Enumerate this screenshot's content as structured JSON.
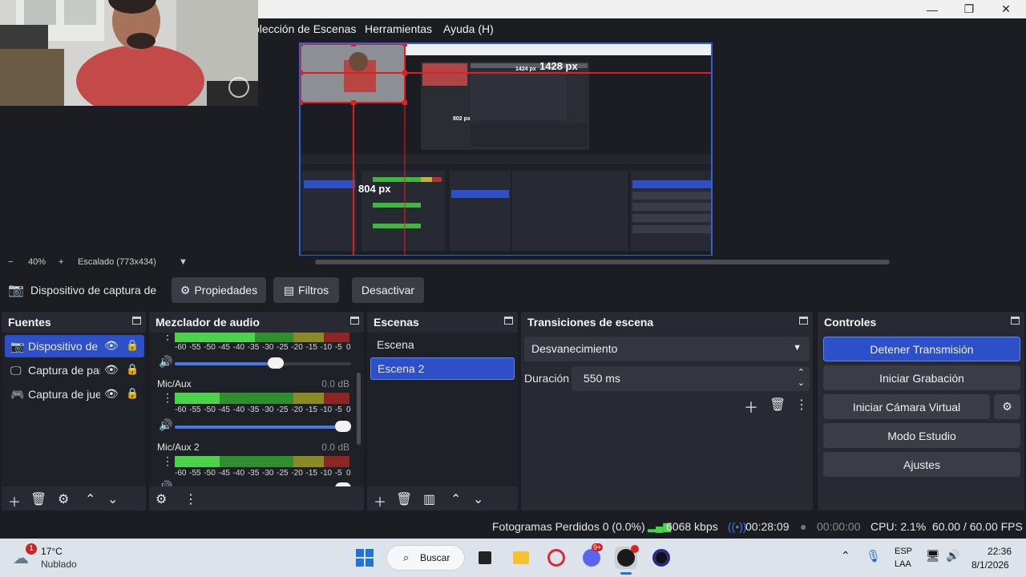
{
  "window": {
    "minimize_glyph": "—",
    "maximize_glyph": "❐",
    "close_glyph": "✕"
  },
  "menu": {
    "items": [
      "olección de Escenas",
      "Herramientas",
      "Ayuda (H)"
    ]
  },
  "preview": {
    "width_label": "1428 px",
    "height_label": "804 px",
    "nested_labels": [
      "1424 px",
      "802 px"
    ]
  },
  "zoom": {
    "minus": "−",
    "value": "40%",
    "plus": "+",
    "scale_label": "Escalado (773x434)"
  },
  "source_toolbar": {
    "source_name": "Dispositivo de captura de v",
    "properties": "Propiedades",
    "filters": "Filtros",
    "deactivate": "Desactivar"
  },
  "sources": {
    "title": "Fuentes",
    "items": [
      {
        "label": "Dispositivo de",
        "icon": "camera-icon",
        "selected": true
      },
      {
        "label": "Captura de par",
        "icon": "monitor-icon",
        "selected": false
      },
      {
        "label": "Captura de jue",
        "icon": "gamepad-icon",
        "selected": false
      }
    ]
  },
  "mixer": {
    "title": "Mezclador de audio",
    "ticks": [
      "-60",
      "-55",
      "-50",
      "-45",
      "-40",
      "-35",
      "-30",
      "-25",
      "-20",
      "-15",
      "-10",
      "-5",
      "0"
    ],
    "channels": [
      {
        "name": "",
        "db": "",
        "volume": 0.62
      },
      {
        "name": "Mic/Aux",
        "db": "0.0 dB",
        "volume": 1.0
      },
      {
        "name": "Mic/Aux 2",
        "db": "0.0 dB",
        "volume": 1.0
      }
    ]
  },
  "scenes": {
    "title": "Escenas",
    "items": [
      {
        "label": "Escena",
        "selected": false
      },
      {
        "label": "Escena 2",
        "selected": true
      }
    ]
  },
  "transitions": {
    "title": "Transiciones de escena",
    "selected": "Desvanecimiento",
    "duration_label": "Duración",
    "duration_value": "550 ms"
  },
  "controls": {
    "title": "Controles",
    "buttons": [
      "Detener Transmisión",
      "Iniciar Grabación",
      "Iniciar Cámara Virtual",
      "Modo Estudio",
      "Ajustes"
    ]
  },
  "status": {
    "dropped": "Fotogramas Perdidos 0 (0.0%)",
    "bitrate": "6068 kbps",
    "stream_time": "00:28:09",
    "record_time": "00:00:00",
    "cpu": "CPU: 2.1%",
    "fps": "60.00 / 60.00 FPS"
  },
  "taskbar": {
    "weather_temp": "17°C",
    "weather_desc": "Nublado",
    "weather_badge": "1",
    "search": "Buscar",
    "discord_badge": "9+",
    "lang_top": "ESP",
    "lang_bottom": "LAA",
    "time": "22:36",
    "date": "8/1/2026"
  },
  "colors": {
    "accent": "#2d4fc8",
    "selected_bg": "#2d4fc8",
    "meter_green": "#4cd34c",
    "meter_yellow": "#c7c736",
    "meter_red": "#c83232"
  }
}
